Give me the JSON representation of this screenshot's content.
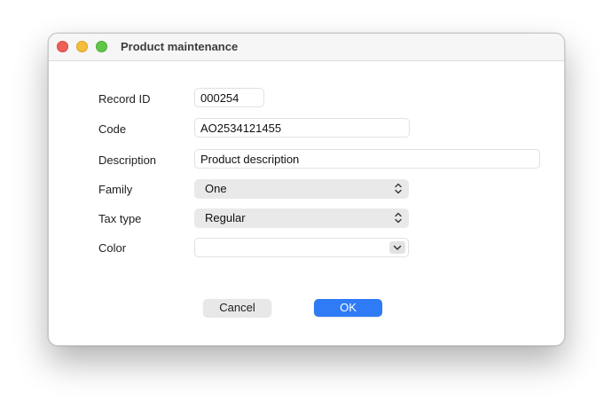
{
  "window": {
    "title": "Product maintenance"
  },
  "form": {
    "record_id": {
      "label": "Record ID",
      "value": "000254"
    },
    "code": {
      "label": "Code",
      "value": "AO2534121455"
    },
    "description": {
      "label": "Description",
      "value": "Product description"
    },
    "family": {
      "label": "Family",
      "value": "One",
      "icon": "chevron-up-down-icon"
    },
    "tax_type": {
      "label": "Tax type",
      "value": "Regular",
      "icon": "chevron-up-down-icon"
    },
    "color": {
      "label": "Color",
      "value": "",
      "icon": "chevron-down-icon"
    }
  },
  "buttons": {
    "cancel_label": "Cancel",
    "ok_label": "OK"
  },
  "colors": {
    "accent": "#2f7bf5",
    "close": "#ee5f57",
    "minimize": "#f4bd3a",
    "zoom": "#5fc748"
  }
}
